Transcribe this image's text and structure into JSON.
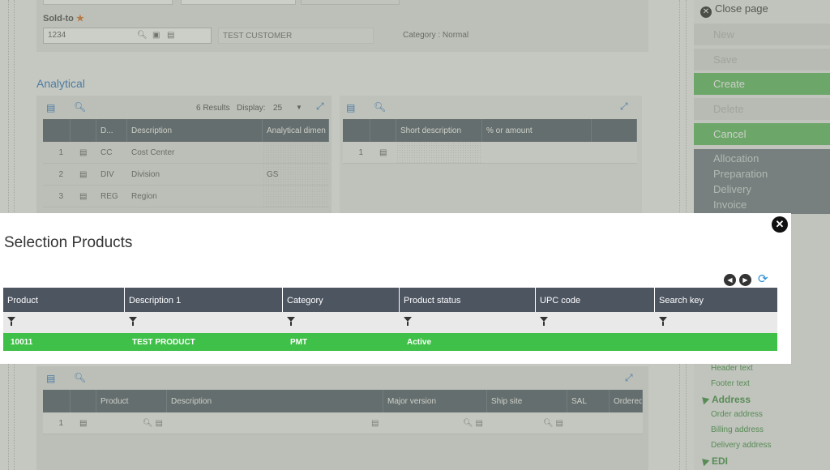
{
  "form": {
    "soldto_label": "Sold-to",
    "required_mark": "★",
    "soldto_value": "1234",
    "customer_name": "TEST CUSTOMER",
    "category_text": "Category : Normal"
  },
  "analytical": {
    "title": "Analytical",
    "left_grid": {
      "results": "6 Results",
      "display_label": "Display:",
      "display_value": "25",
      "headers": [
        "D...",
        "Description",
        "Analytical dimen"
      ],
      "rows": [
        {
          "num": "1",
          "code": "CC",
          "description": "Cost Center",
          "value": ""
        },
        {
          "num": "2",
          "code": "DIV",
          "description": "Division",
          "value": "GS"
        },
        {
          "num": "3",
          "code": "REG",
          "description": "Region",
          "value": ""
        }
      ]
    },
    "right_grid": {
      "headers": [
        "Short description",
        "% or amount"
      ],
      "rows": [
        {
          "num": "1"
        }
      ]
    }
  },
  "lines_grid": {
    "headers": [
      "Product",
      "Description",
      "Major version",
      "Ship site",
      "SAL",
      "Ordered"
    ],
    "rows": [
      {
        "num": "1"
      }
    ]
  },
  "sidebar": {
    "close_label": "Close page",
    "buttons": [
      {
        "label": "New",
        "state": "disabled"
      },
      {
        "label": "Save",
        "state": "disabled"
      },
      {
        "label": "Create",
        "state": "active"
      },
      {
        "label": "Delete",
        "state": "disabled"
      },
      {
        "label": "Cancel",
        "state": "active"
      }
    ],
    "links": [
      "Allocation",
      "Preparation",
      "Delivery",
      "Invoice"
    ],
    "tree": {
      "items_top": [
        "Header text",
        "Footer text"
      ],
      "address_label": "Address",
      "address_items": [
        "Order address",
        "Billing address",
        "Delivery address"
      ],
      "edi_label": "EDI"
    }
  },
  "modal": {
    "title": "Selection Products",
    "columns": [
      "Product",
      "Description 1",
      "Category",
      "Product status",
      "UPC code",
      "Search key"
    ],
    "rows": [
      {
        "product": "10011",
        "description": "TEST PRODUCT",
        "category": "PMT",
        "status": "Active",
        "upc": "",
        "search_key": ""
      }
    ]
  },
  "colors": {
    "accent_green": "#5cb85c",
    "selected_row": "#3fc048",
    "header_dark": "#4d5561",
    "link_blue": "#2a6fbd"
  },
  "icons": [
    "search-icon",
    "expand-icon",
    "detail-icon",
    "lookup-icon",
    "close-icon",
    "prev-icon",
    "next-icon",
    "refresh-icon",
    "filter-icon"
  ]
}
